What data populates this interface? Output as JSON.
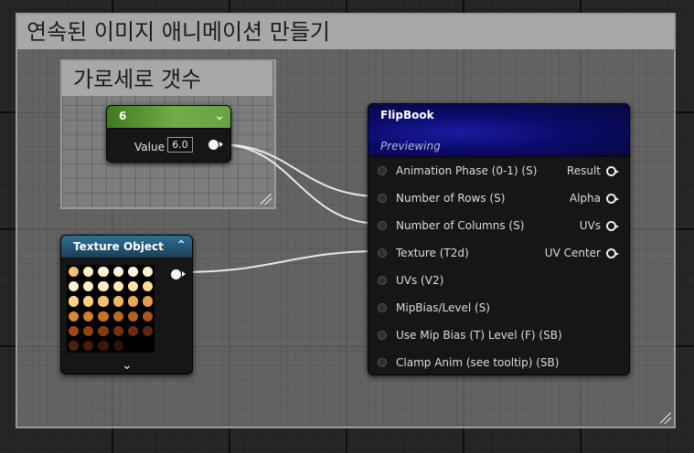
{
  "outer_comment": {
    "title": "연속된 이미지 애니메이션 만들기"
  },
  "inner_comment": {
    "title": "가로세로 갯수"
  },
  "constant_node": {
    "title": "6",
    "collapse_glyph": "⌄",
    "value_label": "Value",
    "value": "6.0"
  },
  "texture_node": {
    "title": "Texture Object",
    "collapse_glyph": "⌃",
    "expand_glyph": "⌄"
  },
  "flipbook_node": {
    "title": "FlipBook",
    "subtitle": "Previewing",
    "inputs": [
      "Animation  Phase (0-1) (S)",
      "Number of Rows (S)",
      "Number of Columns (S)",
      "Texture (T2d)",
      "UVs (V2)",
      "MipBias/Level (S)",
      "Use Mip Bias (T) Level (F) (SB)",
      "Clamp Anim (see tooltip) (SB)"
    ],
    "outputs": [
      "Result",
      "Alpha",
      "UVs",
      "UV Center"
    ]
  },
  "colors": {
    "grid_bg": "#262626",
    "comment_title": "#a8a8a8",
    "constant_header": "#70ad45",
    "texture_header": "#2f6f95",
    "flipbook_header": "#1b1ba0",
    "wire": "#e8e8e8"
  }
}
